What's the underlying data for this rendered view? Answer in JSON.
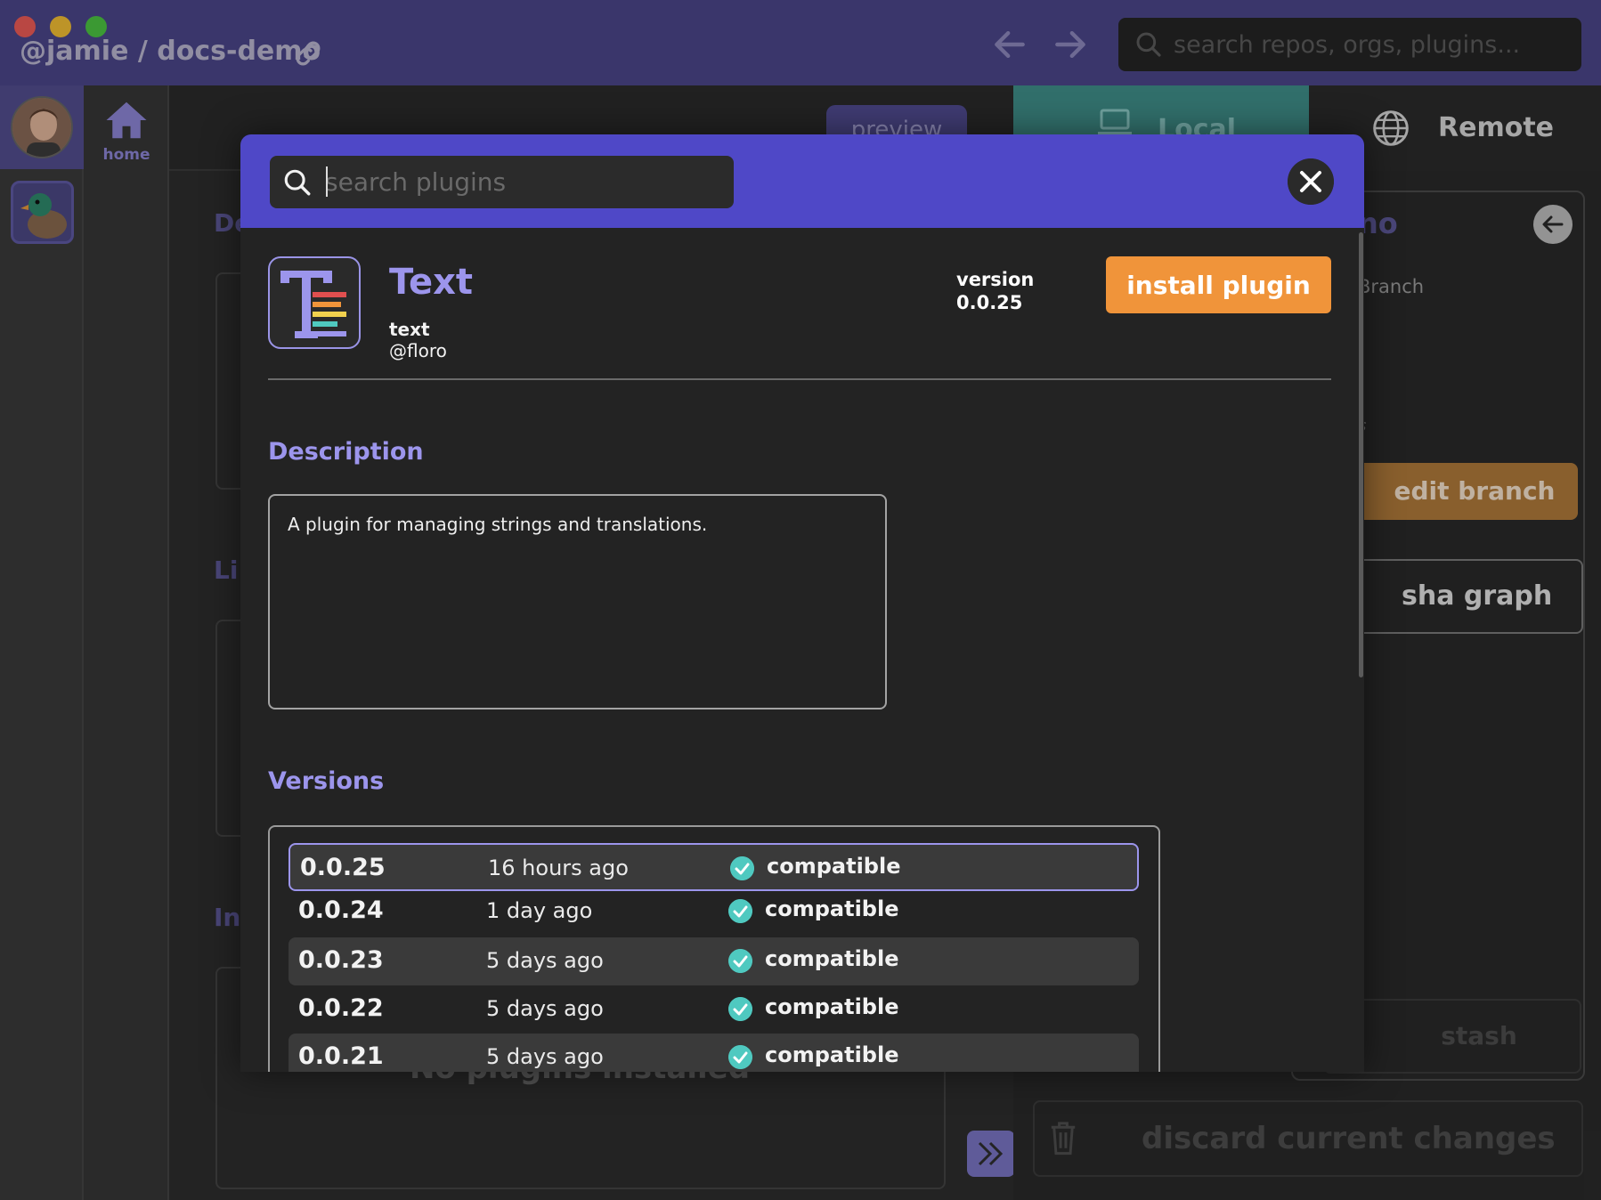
{
  "window": {
    "repo_path": "@jamie / docs-demo",
    "global_search_placeholder": "search repos, orgs, plugins..."
  },
  "sidebar": {
    "home_label": "home"
  },
  "background": {
    "preview_tab": "preview",
    "local_tab": "Local",
    "remote_tab": "Remote",
    "section_letters": [
      "De",
      "Li",
      "In"
    ],
    "no_plugins": "No plugins installed",
    "branch_title_fragment": "no",
    "branch_label_fragment": "Branch",
    "branch_italic_fragment": "s",
    "edit_branch": "edit branch",
    "sha_graph": "sha graph",
    "stash": "stash",
    "discard": "discard current changes"
  },
  "modal": {
    "search_placeholder": "search plugins",
    "plugin": {
      "name": "Text",
      "id": "text",
      "owner": "@floro",
      "version_label": "version",
      "version": "0.0.25",
      "install_label": "install plugin"
    },
    "description_heading": "Description",
    "description": "A plugin for managing strings and translations.",
    "versions_heading": "Versions",
    "versions": [
      {
        "version": "0.0.25",
        "time": "16 hours ago",
        "status": "compatible",
        "selected": true
      },
      {
        "version": "0.0.24",
        "time": "1 day ago",
        "status": "compatible",
        "selected": false
      },
      {
        "version": "0.0.23",
        "time": "5 days ago",
        "status": "compatible",
        "selected": false
      },
      {
        "version": "0.0.22",
        "time": "5 days ago",
        "status": "compatible",
        "selected": false
      },
      {
        "version": "0.0.21",
        "time": "5 days ago",
        "status": "compatible",
        "selected": false
      }
    ]
  },
  "colors": {
    "titlebar": "#4b4689",
    "modal_header": "#4f48c7",
    "accent_purple": "#9c95ec",
    "install_orange": "#f0943a",
    "local_teal": "#3f8f8a",
    "check_teal": "#4fc9c0"
  },
  "icons": {
    "window_controls": [
      "close-dot",
      "minimize-dot",
      "maximize-dot"
    ],
    "link": "link-icon",
    "nav": [
      "arrow-left-icon",
      "arrow-right-icon"
    ],
    "search": "search-icon",
    "close": "close-icon",
    "check": "check-circle-icon"
  }
}
